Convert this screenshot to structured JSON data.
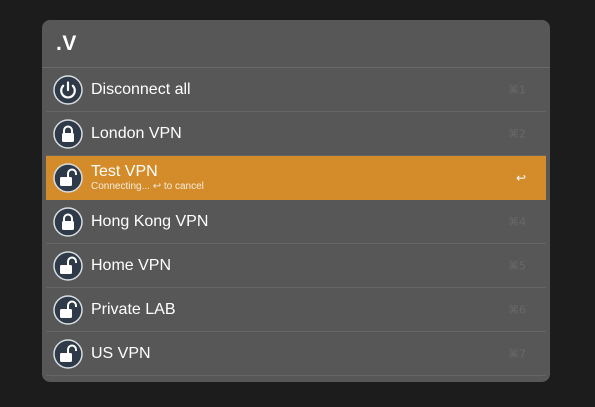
{
  "query": ".V",
  "items": [
    {
      "title": "Disconnect all",
      "subtitle": "",
      "icon": "power-icon",
      "shortcut": "⌘1"
    },
    {
      "title": "London VPN",
      "subtitle": "",
      "icon": "lock-closed-icon",
      "shortcut": "⌘2"
    },
    {
      "title": "Test VPN",
      "subtitle": "Connecting... ↩ to cancel",
      "icon": "lock-open-icon",
      "shortcut": "↩"
    },
    {
      "title": "Hong Kong VPN",
      "subtitle": "",
      "icon": "lock-closed-icon",
      "shortcut": "⌘4"
    },
    {
      "title": "Home VPN",
      "subtitle": "",
      "icon": "lock-open-icon",
      "shortcut": "⌘5"
    },
    {
      "title": "Private LAB",
      "subtitle": "",
      "icon": "lock-open-icon",
      "shortcut": "⌘6"
    },
    {
      "title": "US VPN",
      "subtitle": "",
      "icon": "lock-open-icon",
      "shortcut": "⌘7"
    }
  ],
  "colors": {
    "panel": "#575757",
    "selected": "#d48c2b",
    "icon_fill": "#2e3a47"
  }
}
